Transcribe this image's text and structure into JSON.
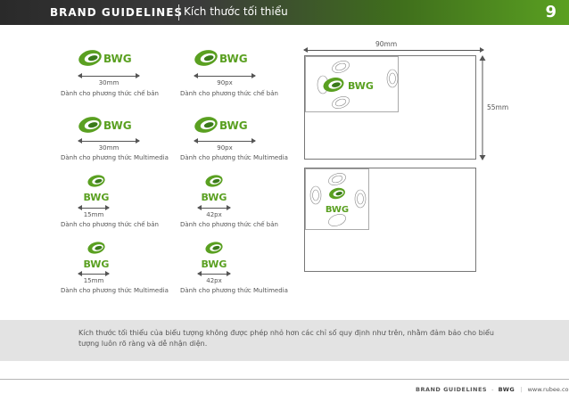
{
  "header": {
    "brand": "BRAND GUIDELINES",
    "subtitle": "Kích thước tối thiểu",
    "page_number": "9"
  },
  "logo_text": "BWG",
  "colors": {
    "brand_green": "#5aa021",
    "dark_green": "#3a7a1a",
    "header_dark": "#2f2f2f"
  },
  "samples": [
    {
      "size": "30mm",
      "caption": "Dành cho phương thức chế bản"
    },
    {
      "size": "90px",
      "caption": "Dành cho phương thức chế bản"
    },
    {
      "size": "30mm",
      "caption": "Dành cho phương thức Multimedia"
    },
    {
      "size": "90px",
      "caption": "Dành cho phương thức Multimedia"
    },
    {
      "size": "15mm",
      "caption": "Dành cho phương thức chế bản"
    },
    {
      "size": "42px",
      "caption": "Dành cho phương thức chế bản"
    },
    {
      "size": "15mm",
      "caption": "Dành cho phương thức Multimedia"
    },
    {
      "size": "42px",
      "caption": "Dành cho phương thức Multimedia"
    }
  ],
  "card": {
    "width_label": "90mm",
    "height_label": "55mm"
  },
  "note": "Kích thước tối thiểu của biểu tượng không được phép nhỏ hơn các chỉ số quy định như trên, nhằm đảm bảo cho biểu tượng luôn rõ ràng và dễ nhận diện.",
  "footer": {
    "brand": "BRAND GUIDELINES",
    "logo": "BWG",
    "url": "www.rubee.com.vn"
  }
}
